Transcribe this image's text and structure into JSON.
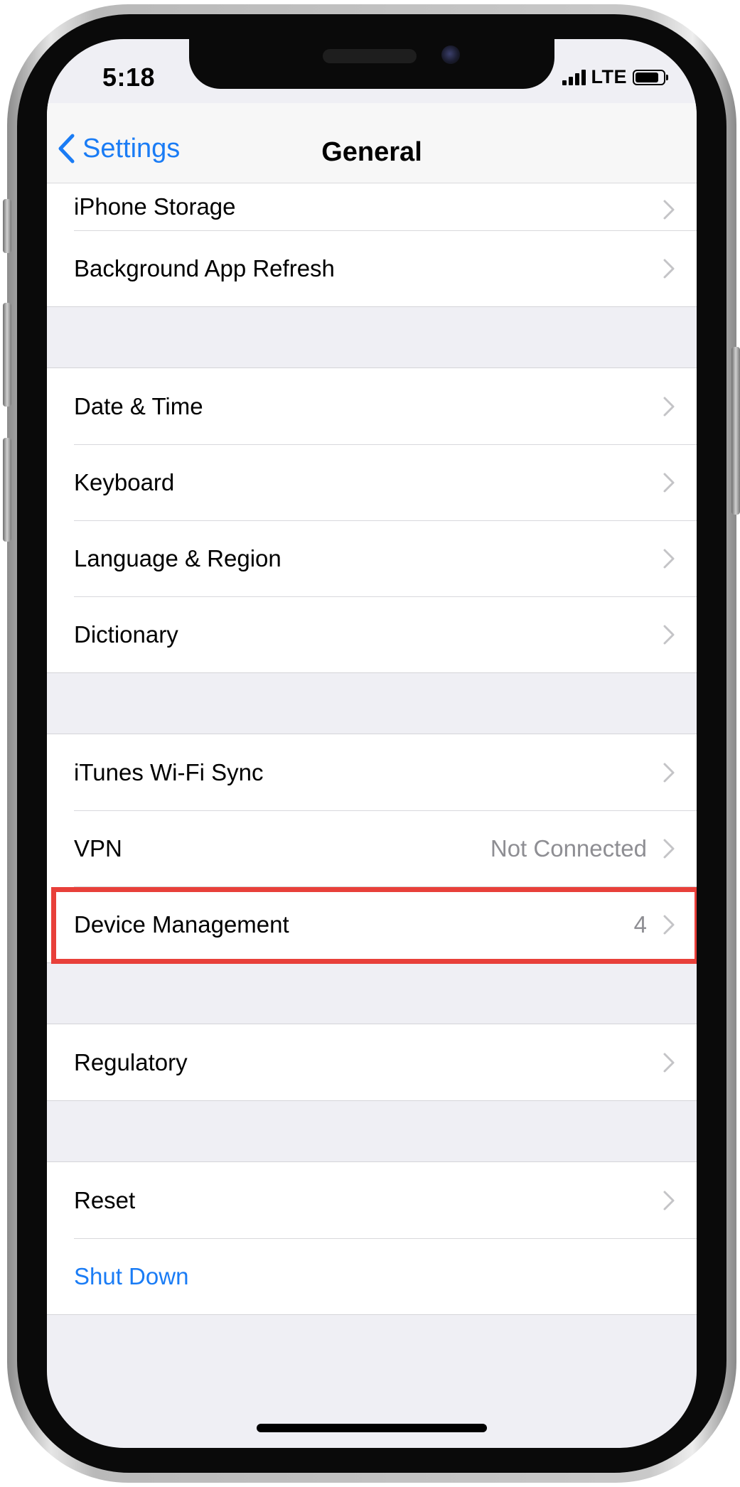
{
  "status_bar": {
    "time": "5:18",
    "network": "LTE",
    "signal_bars": 4,
    "battery_level": 0.85
  },
  "nav": {
    "back_label": "Settings",
    "title": "General"
  },
  "groups": [
    {
      "rows": [
        {
          "label": "iPhone Storage",
          "value": ""
        },
        {
          "label": "Background App Refresh",
          "value": ""
        }
      ]
    },
    {
      "rows": [
        {
          "label": "Date & Time",
          "value": ""
        },
        {
          "label": "Keyboard",
          "value": ""
        },
        {
          "label": "Language & Region",
          "value": ""
        },
        {
          "label": "Dictionary",
          "value": ""
        }
      ]
    },
    {
      "rows": [
        {
          "label": "iTunes Wi-Fi Sync",
          "value": ""
        },
        {
          "label": "VPN",
          "value": "Not Connected"
        },
        {
          "label": "Device Management",
          "value": "4",
          "highlighted": true
        }
      ]
    },
    {
      "rows": [
        {
          "label": "Regulatory",
          "value": ""
        }
      ]
    },
    {
      "rows": [
        {
          "label": "Reset",
          "value": ""
        },
        {
          "label": "Shut Down",
          "value": "",
          "style": "blue"
        }
      ]
    }
  ],
  "colors": {
    "accent": "#1a7cf5",
    "highlight": "#e8403a",
    "background": "#efeff4"
  },
  "icons": {
    "back": "chevron-left-icon",
    "disclosure": "chevron-right-icon"
  }
}
